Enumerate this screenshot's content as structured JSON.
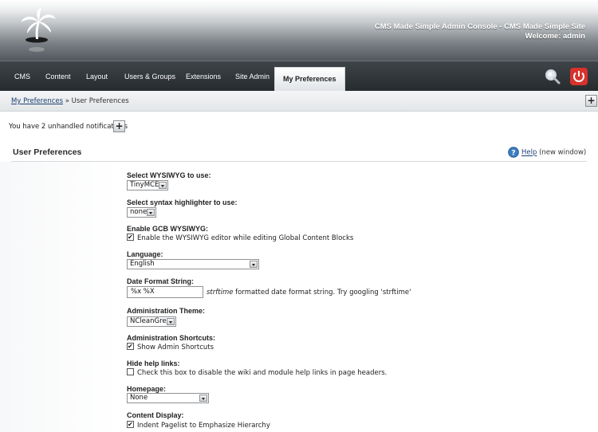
{
  "header": {
    "title": "CMS Made Simple Admin Console - CMS Made Simple Site",
    "welcome": "Welcome: admin",
    "logo": "palm-tree-logo"
  },
  "nav": {
    "items": [
      {
        "label": "CMS"
      },
      {
        "label": "Content"
      },
      {
        "label": "Layout"
      },
      {
        "label": "Users & Groups"
      },
      {
        "label": "Extensions"
      },
      {
        "label": "Site Admin"
      },
      {
        "label": "My Preferences",
        "active": true
      }
    ],
    "icons": {
      "search": "magnifier-icon",
      "logout": "power-icon"
    }
  },
  "breadcrumb": {
    "parent": "My Preferences",
    "separator": "»",
    "current": "User Preferences"
  },
  "notifications": {
    "prefix": "You have ",
    "count": "2",
    "suffix": " unhandled notifications",
    "toggle": "+"
  },
  "section": {
    "title": "User Preferences",
    "help_link": "Help",
    "help_note": "(new window)"
  },
  "form": {
    "wysiwyg": {
      "label": "Select WYSIWYG to use:",
      "value": "TinyMCE"
    },
    "syntax": {
      "label": "Select syntax highlighter to use:",
      "value": "none"
    },
    "gcb": {
      "label": "Enable GCB WYSIWYG:",
      "checkbox_label": "Enable the WYSIWYG editor while editing Global Content Blocks",
      "checked": true
    },
    "language": {
      "label": "Language:",
      "value": "English"
    },
    "date_format": {
      "label": "Date Format String:",
      "value": "%x %X",
      "hint_em": "strftime",
      "hint_rest": " formatted date format string. Try googling 'strftime'"
    },
    "theme": {
      "label": "Administration Theme:",
      "value": "NCleanGrey"
    },
    "shortcuts": {
      "label": "Administration Shortcuts:",
      "checkbox_label": "Show Admin Shortcuts",
      "checked": true
    },
    "help_links": {
      "label": "Hide help links:",
      "checkbox_label": "Check this box to disable the wiki and module help links in page headers.",
      "checked": false
    },
    "homepage": {
      "label": "Homepage:",
      "value": "None"
    },
    "content_display": {
      "label": "Content Display:",
      "checkbox_label": "Indent Pagelist to Emphasize Hierarchy",
      "checked": true
    }
  },
  "colors": {
    "nav_bg": "#262b2e",
    "link": "#1d3f73",
    "logout_red": "#d8322c"
  }
}
